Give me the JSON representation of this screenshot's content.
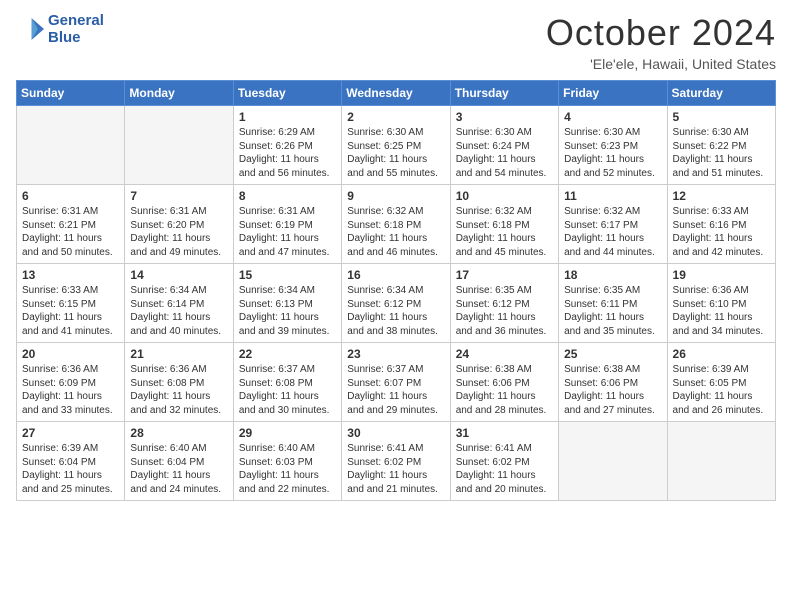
{
  "logo": {
    "line1": "General",
    "line2": "Blue"
  },
  "title": "October 2024",
  "subtitle": "'Ele'ele, Hawaii, United States",
  "days_of_week": [
    "Sunday",
    "Monday",
    "Tuesday",
    "Wednesday",
    "Thursday",
    "Friday",
    "Saturday"
  ],
  "weeks": [
    [
      {
        "day": "",
        "empty": true
      },
      {
        "day": "",
        "empty": true
      },
      {
        "day": "1",
        "sunrise": "6:29 AM",
        "sunset": "6:26 PM",
        "daylight": "11 hours and 56 minutes."
      },
      {
        "day": "2",
        "sunrise": "6:30 AM",
        "sunset": "6:25 PM",
        "daylight": "11 hours and 55 minutes."
      },
      {
        "day": "3",
        "sunrise": "6:30 AM",
        "sunset": "6:24 PM",
        "daylight": "11 hours and 54 minutes."
      },
      {
        "day": "4",
        "sunrise": "6:30 AM",
        "sunset": "6:23 PM",
        "daylight": "11 hours and 52 minutes."
      },
      {
        "day": "5",
        "sunrise": "6:30 AM",
        "sunset": "6:22 PM",
        "daylight": "11 hours and 51 minutes."
      }
    ],
    [
      {
        "day": "6",
        "sunrise": "6:31 AM",
        "sunset": "6:21 PM",
        "daylight": "11 hours and 50 minutes."
      },
      {
        "day": "7",
        "sunrise": "6:31 AM",
        "sunset": "6:20 PM",
        "daylight": "11 hours and 49 minutes."
      },
      {
        "day": "8",
        "sunrise": "6:31 AM",
        "sunset": "6:19 PM",
        "daylight": "11 hours and 47 minutes."
      },
      {
        "day": "9",
        "sunrise": "6:32 AM",
        "sunset": "6:18 PM",
        "daylight": "11 hours and 46 minutes."
      },
      {
        "day": "10",
        "sunrise": "6:32 AM",
        "sunset": "6:18 PM",
        "daylight": "11 hours and 45 minutes."
      },
      {
        "day": "11",
        "sunrise": "6:32 AM",
        "sunset": "6:17 PM",
        "daylight": "11 hours and 44 minutes."
      },
      {
        "day": "12",
        "sunrise": "6:33 AM",
        "sunset": "6:16 PM",
        "daylight": "11 hours and 42 minutes."
      }
    ],
    [
      {
        "day": "13",
        "sunrise": "6:33 AM",
        "sunset": "6:15 PM",
        "daylight": "11 hours and 41 minutes."
      },
      {
        "day": "14",
        "sunrise": "6:34 AM",
        "sunset": "6:14 PM",
        "daylight": "11 hours and 40 minutes."
      },
      {
        "day": "15",
        "sunrise": "6:34 AM",
        "sunset": "6:13 PM",
        "daylight": "11 hours and 39 minutes."
      },
      {
        "day": "16",
        "sunrise": "6:34 AM",
        "sunset": "6:12 PM",
        "daylight": "11 hours and 38 minutes."
      },
      {
        "day": "17",
        "sunrise": "6:35 AM",
        "sunset": "6:12 PM",
        "daylight": "11 hours and 36 minutes."
      },
      {
        "day": "18",
        "sunrise": "6:35 AM",
        "sunset": "6:11 PM",
        "daylight": "11 hours and 35 minutes."
      },
      {
        "day": "19",
        "sunrise": "6:36 AM",
        "sunset": "6:10 PM",
        "daylight": "11 hours and 34 minutes."
      }
    ],
    [
      {
        "day": "20",
        "sunrise": "6:36 AM",
        "sunset": "6:09 PM",
        "daylight": "11 hours and 33 minutes."
      },
      {
        "day": "21",
        "sunrise": "6:36 AM",
        "sunset": "6:08 PM",
        "daylight": "11 hours and 32 minutes."
      },
      {
        "day": "22",
        "sunrise": "6:37 AM",
        "sunset": "6:08 PM",
        "daylight": "11 hours and 30 minutes."
      },
      {
        "day": "23",
        "sunrise": "6:37 AM",
        "sunset": "6:07 PM",
        "daylight": "11 hours and 29 minutes."
      },
      {
        "day": "24",
        "sunrise": "6:38 AM",
        "sunset": "6:06 PM",
        "daylight": "11 hours and 28 minutes."
      },
      {
        "day": "25",
        "sunrise": "6:38 AM",
        "sunset": "6:06 PM",
        "daylight": "11 hours and 27 minutes."
      },
      {
        "day": "26",
        "sunrise": "6:39 AM",
        "sunset": "6:05 PM",
        "daylight": "11 hours and 26 minutes."
      }
    ],
    [
      {
        "day": "27",
        "sunrise": "6:39 AM",
        "sunset": "6:04 PM",
        "daylight": "11 hours and 25 minutes."
      },
      {
        "day": "28",
        "sunrise": "6:40 AM",
        "sunset": "6:04 PM",
        "daylight": "11 hours and 24 minutes."
      },
      {
        "day": "29",
        "sunrise": "6:40 AM",
        "sunset": "6:03 PM",
        "daylight": "11 hours and 22 minutes."
      },
      {
        "day": "30",
        "sunrise": "6:41 AM",
        "sunset": "6:02 PM",
        "daylight": "11 hours and 21 minutes."
      },
      {
        "day": "31",
        "sunrise": "6:41 AM",
        "sunset": "6:02 PM",
        "daylight": "11 hours and 20 minutes."
      },
      {
        "day": "",
        "empty": true
      },
      {
        "day": "",
        "empty": true
      }
    ]
  ],
  "labels": {
    "sunrise": "Sunrise:",
    "sunset": "Sunset:",
    "daylight": "Daylight:"
  }
}
